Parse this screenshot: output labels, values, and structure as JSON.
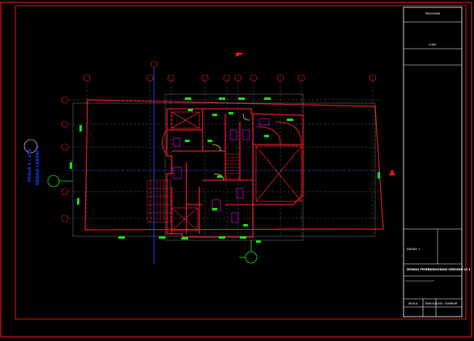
{
  "title_block": {
    "header": "PROGRAM",
    "project": "LUAS",
    "sheet_label": "DENAH 1",
    "drawing_title": "DENAH PEMBANGUNAN GEDUNG LT.1",
    "footer_left": "SKALA",
    "footer_mid": "TANGGAL",
    "footer_right": "NO. GAMBAR"
  },
  "annotations": {
    "side_title": "DENAH LANTAI 1",
    "side_scale": "SKALA 1 : 100"
  },
  "colors": {
    "border": "#e21414",
    "walls": "#e01a2c",
    "grid": "#ff2020",
    "accent_green": "#18e018",
    "accent_blue": "#1e3cff",
    "magenta": "#e100e1"
  }
}
